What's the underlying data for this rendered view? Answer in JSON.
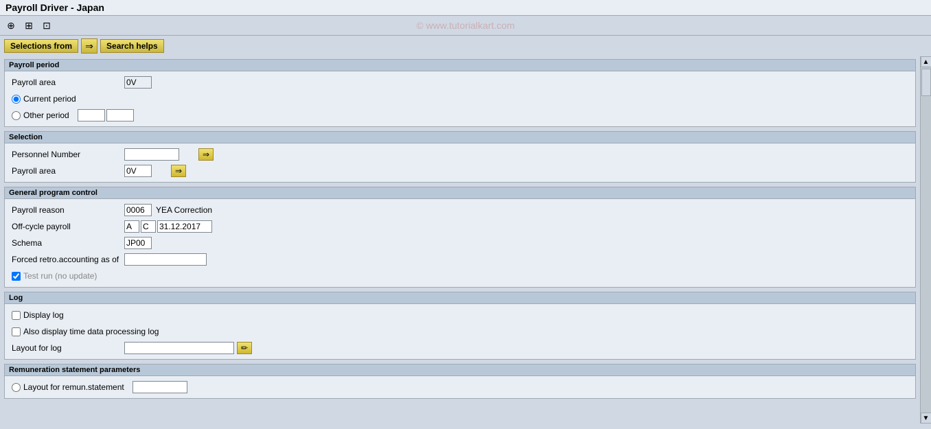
{
  "title": "Payroll Driver - Japan",
  "watermark": "© www.tutorialkart.com",
  "toolbar": {
    "icons": [
      "⊕",
      "⊞",
      "⊡"
    ]
  },
  "buttons": {
    "selections_from": "Selections from",
    "search_helps": "Search helps"
  },
  "sections": {
    "payroll_period": {
      "header": "Payroll period",
      "payroll_area_label": "Payroll area",
      "payroll_area_value": "0V",
      "current_period_label": "Current period",
      "other_period_label": "Other period",
      "other_period_val1": "",
      "other_period_val2": ""
    },
    "selection": {
      "header": "Selection",
      "personnel_number_label": "Personnel Number",
      "personnel_number_value": "",
      "payroll_area_label": "Payroll area",
      "payroll_area_value": "0V"
    },
    "general_program_control": {
      "header": "General program control",
      "payroll_reason_label": "Payroll reason",
      "payroll_reason_code": "0006",
      "payroll_reason_text": "YEA Correction",
      "off_cycle_payroll_label": "Off-cycle payroll",
      "off_cycle_val1": "A",
      "off_cycle_val2": "C",
      "off_cycle_date": "31.12.2017",
      "schema_label": "Schema",
      "schema_value": "JP00",
      "forced_retro_label": "Forced retro.accounting as of",
      "forced_retro_value": "",
      "test_run_label": "Test run (no update)",
      "test_run_checked": true
    },
    "log": {
      "header": "Log",
      "display_log_label": "Display log",
      "display_log_checked": false,
      "time_data_label": "Also display time data processing log",
      "time_data_checked": false,
      "layout_label": "Layout for log",
      "layout_value": ""
    },
    "remuneration": {
      "header": "Remuneration statement parameters",
      "layout_label": "Layout for remun.statement",
      "layout_value": ""
    }
  }
}
